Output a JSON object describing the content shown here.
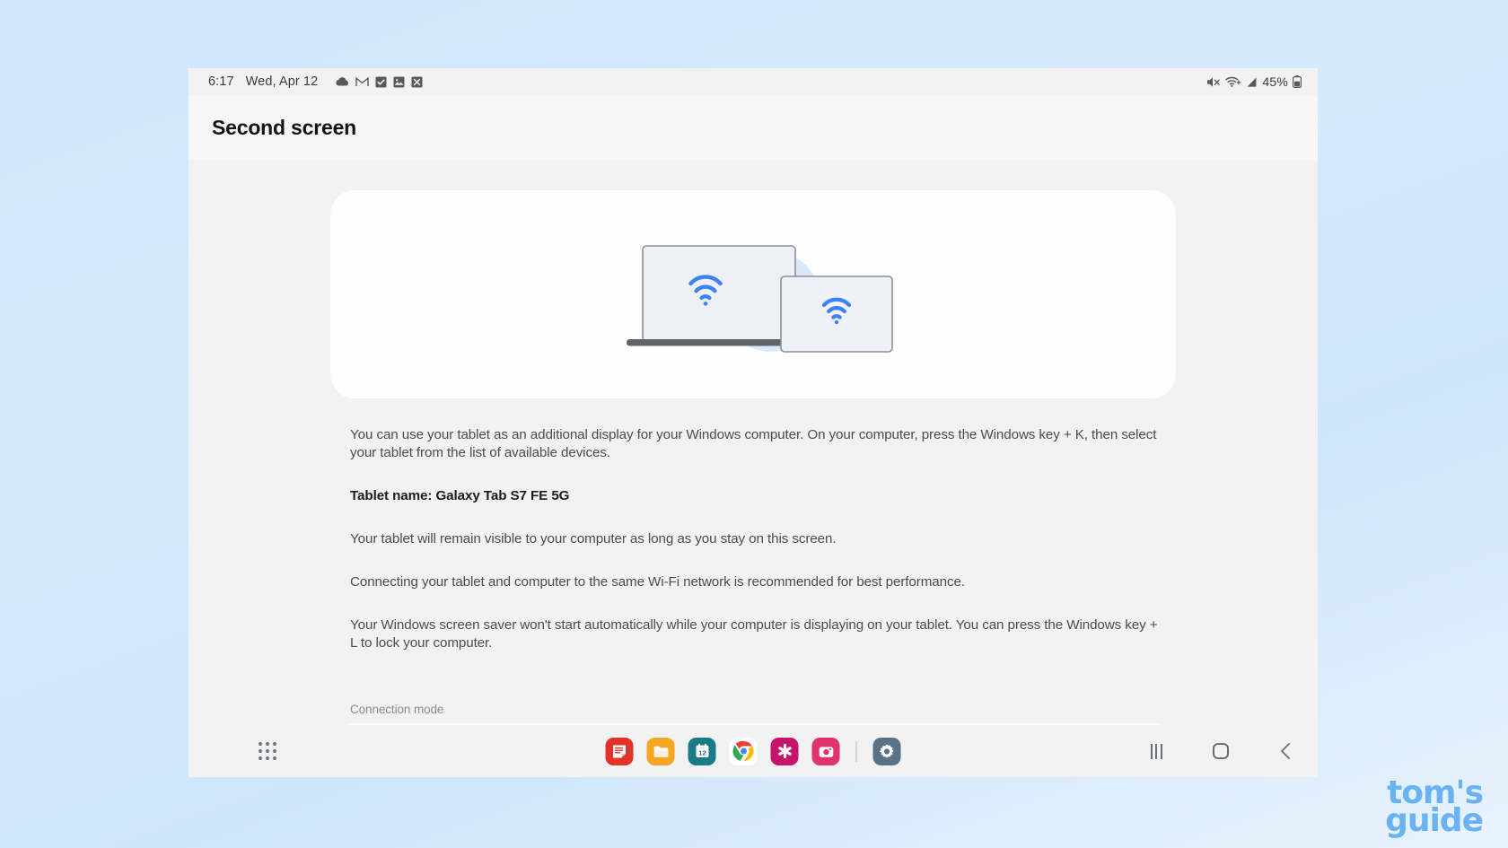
{
  "status_bar": {
    "time": "6:17",
    "date": "Wed, Apr 12",
    "left_icons": [
      "cloud-icon",
      "gmail-icon",
      "checkbox-icon",
      "photo-icon",
      "x-box-icon"
    ],
    "right_icons": [
      "mute-icon",
      "wifi-plus-icon",
      "signal-icon"
    ],
    "battery_percent": "45%"
  },
  "header": {
    "title": "Second screen"
  },
  "hero": {
    "illustration_name": "laptop-and-tablet-wifi-illustration",
    "accent_color": "#3b82f6",
    "circle_color": "#d6e6fb"
  },
  "info": {
    "paragraph_1": "You can use your tablet as an additional display for your Windows computer. On your computer, press the Windows key + K, then select your tablet from the list of available devices.",
    "tablet_name_line": "Tablet name: Galaxy Tab S7 FE 5G",
    "paragraph_2": "Your tablet will remain visible to your computer as long as you stay on this screen.",
    "paragraph_3": "Connecting your tablet and computer to the same Wi-Fi network is recommended for best performance.",
    "paragraph_4": "Your Windows screen saver won't start automatically while your computer is displaying on your tablet. You can press the Windows key + L to lock your computer."
  },
  "connection_mode": {
    "label": "Connection mode"
  },
  "taskbar": {
    "app_drawer_name": "apps-grid-icon",
    "dock_apps": [
      {
        "name": "samsung-notes",
        "color": "#e0342a"
      },
      {
        "name": "my-files",
        "color": "#f5a623"
      },
      {
        "name": "calendar",
        "color": "#1a7a85",
        "day": "12"
      },
      {
        "name": "chrome",
        "color": "#ffffff"
      },
      {
        "name": "samsung-members",
        "color": "#c4156b"
      },
      {
        "name": "gallery",
        "color": "#e0336b"
      },
      {
        "name": "settings",
        "color": "#5a7285"
      }
    ],
    "nav": [
      {
        "name": "recents-button"
      },
      {
        "name": "home-button"
      },
      {
        "name": "back-button"
      }
    ]
  },
  "watermark": {
    "line1": "tom's",
    "line2": "guide",
    "color": "#69b3f5"
  }
}
